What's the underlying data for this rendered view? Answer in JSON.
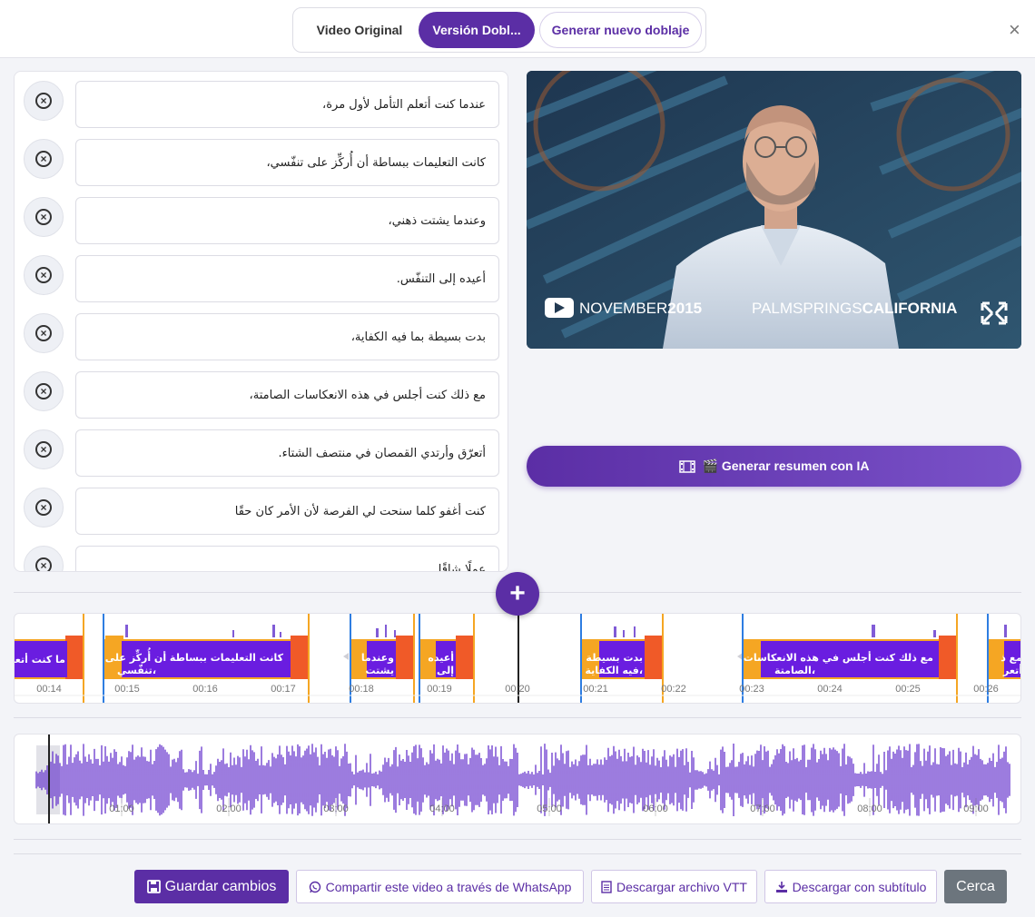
{
  "header": {
    "tabs": [
      {
        "label": "Video Original"
      },
      {
        "label": "Versión Dobl..."
      },
      {
        "label": "Generar nuevo doblaje"
      }
    ],
    "close_symbol": "×"
  },
  "subtitles": [
    "عندما كنت أتعلم التأمل لأول مرة،",
    "كانت التعليمات ببساطة أن أُركِّز على تنفّسي،",
    "وعندما يشتت ذهني،",
    "أعيده إلى التنفّس.",
    "بدت بسيطة بما فيه الكفاية،",
    "مع ذلك كنت أجلس في هذه الانعكاسات الصامتة،",
    "أتعرّق وأرتدي القمصان في منتصف الشتاء.",
    "كنت أغفو كلما سنحت لي الفرصة لأن الأمر كان حقًا",
    "عملًا شاقًا"
  ],
  "video": {
    "date_light": "NOVEMBER",
    "date_bold": "2015",
    "place_light": "PALMSPRINGS",
    "place_bold": "CALIFORNIA"
  },
  "generate_button": {
    "label": "🎬 Generar resumen con IA",
    "icon": "film-icon"
  },
  "add_button": {
    "symbol": "+"
  },
  "timeline": {
    "ticks": [
      "00:14",
      "00:15",
      "00:16",
      "00:17",
      "00:18",
      "00:19",
      "00:20",
      "00:21",
      "00:22",
      "00:23",
      "00:24",
      "00:25",
      "00:26"
    ],
    "segments": [
      {
        "text": "...ما كنت أتعل",
        "text2": ""
      },
      {
        "text": "كانت التعليمات ببساطة أن أُركِّز على",
        "text2": "تنفّسي،"
      },
      {
        "text": "وعندما",
        "text2": "يشتت"
      },
      {
        "text": "أعيده",
        "text2": "إلى"
      },
      {
        "text": "بدت بسيطة بما",
        "text2": "فيه الكفاية،"
      },
      {
        "text": "مع ذلك كنت أجلس في هذه الانعكاسات",
        "text2": "الصامتة،"
      },
      {
        "text": "مع ذ",
        "text2": "أتعر"
      }
    ]
  },
  "overview": {
    "ticks": [
      "01:00",
      "02:00",
      "03:00",
      "04:00",
      "05:00",
      "06:00",
      "07:00",
      "08:00",
      "09:00"
    ]
  },
  "footer": {
    "save": {
      "label": "Guardar cambios",
      "icon": "save-icon"
    },
    "whatsapp": {
      "label": "Compartir este video a través de WhatsApp",
      "icon": "whatsapp-icon"
    },
    "vtt": {
      "label": "Descargar archivo VTT",
      "icon": "document-icon"
    },
    "subtitle": {
      "label": "Descargar con subtítulo",
      "icon": "download-icon"
    },
    "close": {
      "label": "Cerca"
    }
  },
  "colors": {
    "accent": "#5b2ea5",
    "segment": "#6a1de0",
    "handle_orange": "#f5a623",
    "handle_red": "#f05a28",
    "waveform": "#5a24c9"
  }
}
